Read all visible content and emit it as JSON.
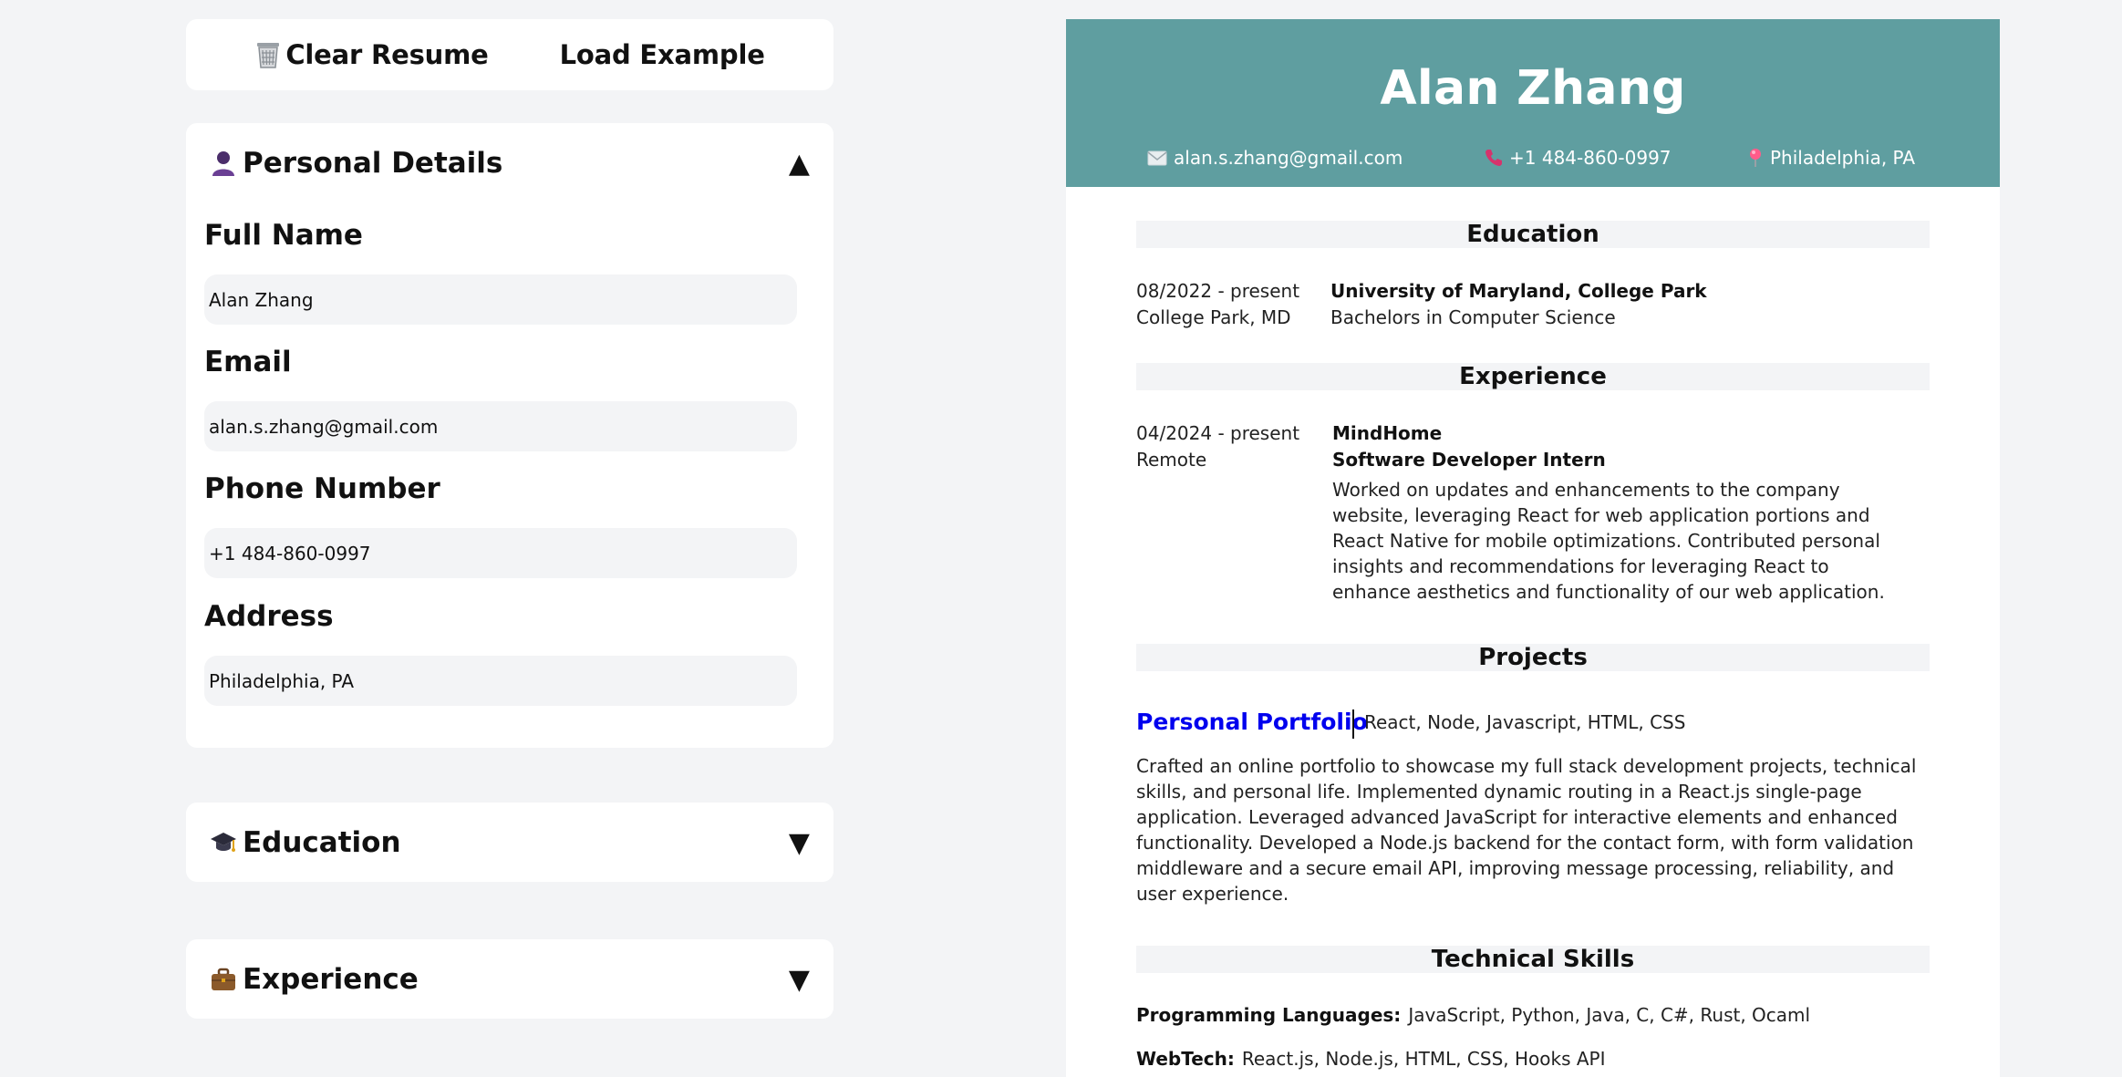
{
  "toolbar": {
    "clear_label": "Clear Resume",
    "clear_icon": "trash-icon",
    "load_label": "Load Example"
  },
  "personal": {
    "title": "Personal Details",
    "icon": "user-icon",
    "caret": "▲",
    "fields": [
      {
        "label": "Full Name",
        "value": "Alan Zhang"
      },
      {
        "label": "Email",
        "value": "alan.s.zhang@gmail.com"
      },
      {
        "label": "Phone Number",
        "value": "+1 484-860-0997"
      },
      {
        "label": "Address",
        "value": "Philadelphia, PA"
      }
    ]
  },
  "education_panel": {
    "title": "Education",
    "icon": "graduation-cap-icon",
    "caret": "▼"
  },
  "experience_panel": {
    "title": "Experience",
    "icon": "briefcase-icon",
    "caret": "▼"
  },
  "resume": {
    "header_color": "#5f9ea0",
    "name": "Alan Zhang",
    "email": "alan.s.zhang@gmail.com",
    "phone": "+1 484-860-0997",
    "location": "Philadelphia, PA",
    "sections": {
      "education": "Education",
      "experience": "Experience",
      "projects": "Projects",
      "skills": "Technical Skills"
    },
    "education": [
      {
        "dates": "08/2022 - present",
        "location": "College Park, MD",
        "school": "University of Maryland, College Park",
        "degree": "Bachelors in Computer Science"
      }
    ],
    "experience": [
      {
        "dates": "04/2024 - present",
        "location": "Remote",
        "company": "MindHome",
        "role": "Software Developer Intern",
        "description": "Worked on updates and enhancements to the company website, leveraging React for web application portions and React Native for mobile optimizations. Contributed personal insights and recommendations for leveraging React to enhance aesthetics and functionality of our web application."
      }
    ],
    "projects": [
      {
        "name": "Personal Portfolio",
        "tech": "React, Node, Javascript, HTML, CSS",
        "description": "Crafted an online portfolio to showcase my full stack development projects, technical skills, and personal life. Implemented dynamic routing in a React.js single-page application. Leveraged advanced JavaScript for interactive elements and enhanced functionality. Developed a Node.js backend for the contact form, with form validation middleware and a secure email API, improving message processing, reliability, and user experience."
      }
    ],
    "skills": [
      {
        "label": "Programming Languages:",
        "value": "JavaScript, Python, Java, C, C#, Rust, Ocaml"
      },
      {
        "label": "WebTech:",
        "value": "React.js, Node.js, HTML, CSS, Hooks API"
      }
    ]
  }
}
